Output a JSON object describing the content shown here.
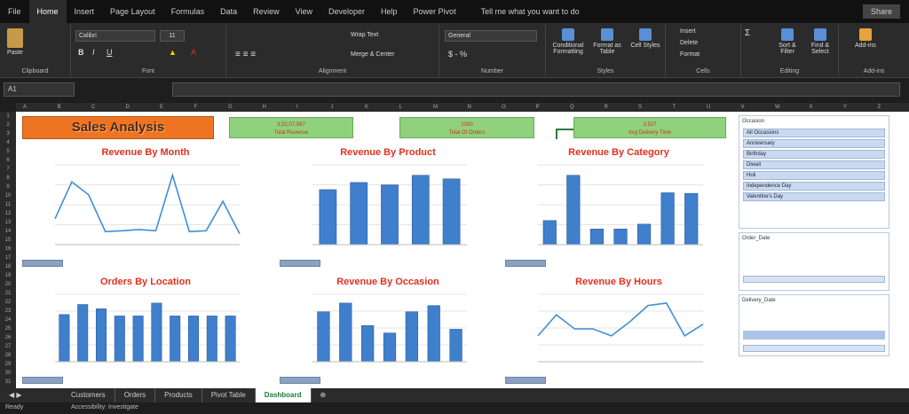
{
  "ribbon_tabs": [
    "File",
    "Home",
    "Insert",
    "Page Layout",
    "Formulas",
    "Data",
    "Review",
    "View",
    "Developer",
    "Help",
    "Power Pivot"
  ],
  "active_tab": "Home",
  "tell_me": "Tell me what you want to do",
  "share": "Share",
  "ribbon": {
    "clipboard": "Clipboard",
    "paste": "Paste",
    "font": "Font",
    "font_name": "Calibri",
    "font_size": "11",
    "alignment": "Alignment",
    "wrap_text": "Wrap Text",
    "merge": "Merge & Center",
    "number": "Number",
    "number_format": "General",
    "styles": "Styles",
    "cond_format": "Conditional Formatting",
    "format_table": "Format as Table",
    "cell_styles": "Cell Styles",
    "cells": "Cells",
    "insert": "Insert",
    "delete": "Delete",
    "format": "Format",
    "editing": "Editing",
    "sort_filter": "Sort & Filter",
    "find_select": "Find & Select",
    "addins_group": "Add-ins",
    "addins": "Add-ins"
  },
  "name_box": "A1",
  "columns": [
    "A",
    "B",
    "C",
    "D",
    "E",
    "F",
    "G",
    "H",
    "I",
    "J",
    "K",
    "L",
    "M",
    "N",
    "O",
    "P",
    "Q",
    "R",
    "S",
    "T",
    "U",
    "V",
    "W",
    "X",
    "Y",
    "Z"
  ],
  "dashboard": {
    "title": "Sales Analysis",
    "cards": [
      {
        "value": "3,52,07,997",
        "label": "Total Revenue"
      },
      {
        "value": "1000",
        "label": "Total Of Orders"
      },
      {
        "value": "3,527",
        "label": "Avg Delivery Time"
      }
    ],
    "charts": [
      {
        "id": "month",
        "title": "Revenue By Month"
      },
      {
        "id": "product",
        "title": "Revenue By Product"
      },
      {
        "id": "category",
        "title": "Revenue By Category"
      },
      {
        "id": "location",
        "title": "Orders By Location"
      },
      {
        "id": "occasion",
        "title": "Revenue By Occasion"
      },
      {
        "id": "hours",
        "title": "Revenue By Hours"
      }
    ],
    "slicers": {
      "occasion_title": "Occasion",
      "occasion_items": [
        "All Occasions",
        "Anniversary",
        "Birthday",
        "Diwali",
        "Holi",
        "Independence Day",
        "Valentine's Day"
      ],
      "order_date_title": "Order_Date",
      "delivery_date_title": "Delivery_Date"
    }
  },
  "sheet_tabs": [
    "Customers",
    "Orders",
    "Products",
    "Pivot Table",
    "Dashboard"
  ],
  "active_sheet": "Dashboard",
  "status": {
    "ready": "Ready",
    "accessibility": "Accessibility: Investigate"
  },
  "chart_data": [
    {
      "type": "line",
      "title": "Revenue By Month",
      "y": [
        60000,
        145000,
        115000,
        30000,
        32000,
        35000,
        32000,
        160000,
        30000,
        32000,
        100000,
        25000
      ]
    },
    {
      "type": "bar",
      "title": "Revenue By Product",
      "y": [
        4600000,
        5200000,
        5000000,
        5800000,
        5500000
      ]
    },
    {
      "type": "bar",
      "title": "Revenue By Category",
      "y": [
        4000000,
        11500000,
        2600000,
        2600000,
        3400000,
        8600000,
        8500000
      ]
    },
    {
      "type": "bar",
      "title": "Orders By Location",
      "y": [
        33,
        40,
        37,
        32,
        32,
        41,
        32,
        32,
        32,
        32
      ]
    },
    {
      "type": "bar",
      "title": "Revenue By Occasion",
      "y": [
        4000000,
        4700000,
        2900000,
        2300000,
        4000000,
        4500000,
        2600000
      ]
    },
    {
      "type": "line",
      "title": "Revenue By Hours",
      "y": [
        1100000,
        2000000,
        1400000,
        1400000,
        1100000,
        1700000,
        2400000,
        2500000,
        1100000,
        1600000
      ]
    }
  ]
}
